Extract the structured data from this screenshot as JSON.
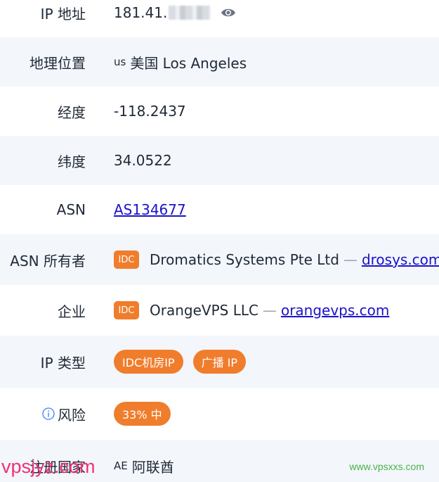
{
  "rows": [
    {
      "label": "IP 地址",
      "ip_visible": "181.41.",
      "eye_icon": "eye-icon"
    },
    {
      "label": "地理位置",
      "country_code": "us",
      "location": "美国 Los Angeles"
    },
    {
      "label": "经度",
      "value": "-118.2437"
    },
    {
      "label": "纬度",
      "value": "34.0522"
    },
    {
      "label": "ASN",
      "link": "AS134677"
    },
    {
      "label": "ASN 所有者",
      "badge": "IDC",
      "name": "Dromatics Systems Pte Ltd",
      "dash": "—",
      "link": "drosys.com"
    },
    {
      "label": "企业",
      "badge": "IDC",
      "name": "OrangeVPS LLC",
      "dash": "—",
      "link": "orangevps.com"
    },
    {
      "label": "IP 类型",
      "tags": [
        "IDC机房IP",
        "广播 IP"
      ]
    },
    {
      "label": "风险",
      "info_icon": "info-icon",
      "risk": "33% 中"
    },
    {
      "label": "注册国家",
      "country_code": "AE",
      "country": "阿联酋"
    }
  ],
  "watermarks": {
    "left": "vpsjyz.com",
    "right": "www.vpsxxs.com"
  },
  "colors": {
    "accent": "#f07d2c",
    "link": "#1a12c9",
    "row_alt": "#f3f6fb",
    "info": "#3b82f6"
  }
}
